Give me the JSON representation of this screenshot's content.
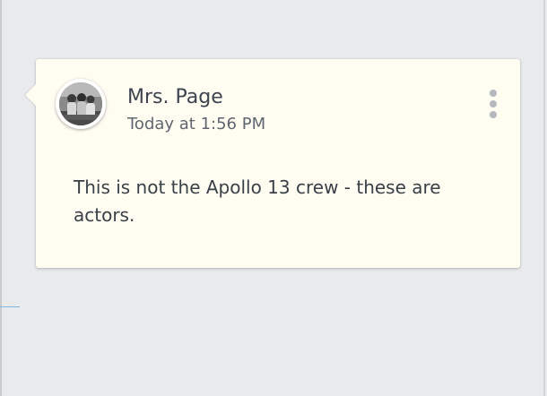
{
  "comment": {
    "author": "Mrs. Page",
    "timestamp": "Today at 1:56 PM",
    "text": "This is not the Apollo 13 crew - these are actors.",
    "avatar_icon": "user-photo-avatar",
    "menu_icon": "more-vertical-icon"
  },
  "colors": {
    "page_background": "#e9eaec",
    "card_background": "#fffdf2",
    "text_primary": "#3d4450",
    "accent_line": "#7db7e6"
  }
}
